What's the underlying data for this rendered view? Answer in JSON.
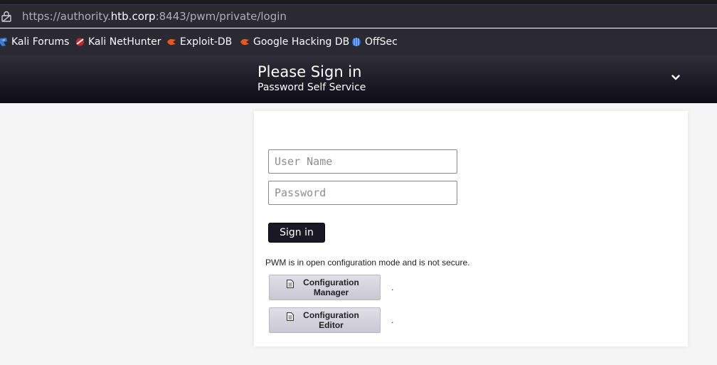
{
  "browser": {
    "url_prefix": "https://authority.",
    "url_domain": "htb.corp",
    "url_suffix": ":8443/pwm/private/login",
    "bookmarks": [
      {
        "label": "Kali Forums",
        "icon": "kali-dragon-icon"
      },
      {
        "label": "Kali NetHunter",
        "icon": "nethunter-icon"
      },
      {
        "label": "Exploit-DB",
        "icon": "exploit-db-icon"
      },
      {
        "label": "Google Hacking DB",
        "icon": "ghdb-icon"
      },
      {
        "label": "OffSec",
        "icon": "offsec-icon"
      }
    ]
  },
  "header": {
    "title": "Please Sign in",
    "subtitle": "Password Self Service"
  },
  "form": {
    "username_placeholder": "User Name",
    "username_value": "",
    "password_placeholder": "Password",
    "password_value": "",
    "signin_label": "Sign in"
  },
  "config": {
    "warning": "PWM is in open configuration mode and is not secure.",
    "manager_label": "Configuration Manager",
    "editor_label": "Configuration Editor",
    "manager_suffix": ".",
    "editor_suffix": "."
  },
  "colors": {
    "header_bg": "#1a1924",
    "button_bg": "#1a1824",
    "chrome_bg": "#2b2a33"
  }
}
